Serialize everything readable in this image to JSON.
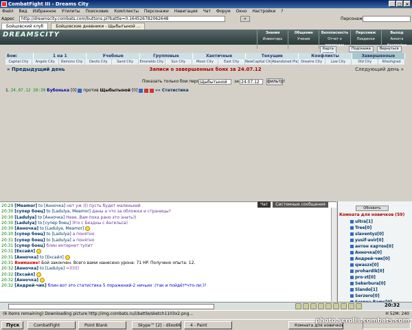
{
  "window": {
    "title": "CombatFight III - Dreams City"
  },
  "menu": [
    "Файл",
    "Вид",
    "Избранное",
    "Утилиты",
    "Поисковик",
    "Комплекты",
    "Персонажи",
    "Навигация",
    "Чат",
    "Форум",
    "Окно",
    "Настройки",
    "?"
  ],
  "address": {
    "label": "Адрес",
    "url": "http://dreamscity.combats.com/buttons.pl?battle=0.164526782062648",
    "go_label": "»",
    "person_label": "Персонаж:"
  },
  "tabs": [
    "Бойцовский клуб",
    "Бойцовские дневники - Щыбытыной ..."
  ],
  "dream": {
    "logo": "DREAMSCITY",
    "menus": [
      {
        "top": "Знания",
        "bottom": "Инвентарь"
      },
      {
        "top": "Общение",
        "bottom": "Учение"
      },
      {
        "top": "Безопасность",
        "bottom": "Отчет о переводах"
      },
      {
        "top": "Персонаж",
        "bottom": "Поединки"
      },
      {
        "top": "Выход",
        "bottom": "Анкета Настройки"
      }
    ]
  },
  "top_buttons": [
    "Карта миров",
    "Подсказка",
    "Вернуться"
  ],
  "categories": {
    "label": "Бои:",
    "items": [
      "1 на 1",
      "Учебные",
      "Групповые",
      "Хаотичные",
      "Текущие",
      "Конфликты",
      "Завершенные"
    ]
  },
  "subcities": [
    "Capital City",
    "Angels City",
    "Demons City",
    "Devils City",
    "Sand City",
    "Emeralds City",
    "Sun City",
    "Moon City",
    "East City",
    "NewCapital City",
    "Abandoned Plain",
    "Dreams City",
    "Low City",
    "Old City",
    "Kitezhgrad"
  ],
  "nav": {
    "prev": "« Предыдущий день",
    "title": "Записи о завершенных боях за 24.07.12",
    "next": "Следующий день »"
  },
  "filter": {
    "label": "Показать только бои персонажа:",
    "person": "Щыбытыной",
    "for_label": "за",
    "date": "24.07.12",
    "button": "фильтр!"
  },
  "battle": {
    "num": "1.",
    "date": "24.07.12 20:30",
    "p1": "Бубонька",
    "p1_level": "[0]",
    "vs": "против",
    "p2": "Щыбытыной",
    "p2_level": "[0]",
    "link": "»»",
    "stats": "Статистика"
  },
  "chat": {
    "tabs": [
      "Чат",
      "Системные сообщения"
    ],
    "lines": [
      {
        "t": "20:29",
        "n": "[Meamor]",
        "to": "to [Анночка]",
        "m": "нет уж ))) пусть будет маленький",
        "c": "pm"
      },
      {
        "t": "20:30",
        "n": "[супер боец]",
        "to": "to [Ladulya, Meamor]",
        "m": "даны а что за обложки и страницы?",
        "c": "pm"
      },
      {
        "t": "20:30",
        "n": "[Ladulya]",
        "to": "to [Анночка]",
        "m": "Неее..Вам пока рано это знать))",
        "c": "pm"
      },
      {
        "t": "20:30",
        "n": "[Ladulya]",
        "to": "to [супер боец]",
        "m": "Это с Бездны с Ангельса)",
        "c": "pm"
      },
      {
        "t": "20:30",
        "n": "[Анночка]",
        "to": "to [Ladulya, Meamor]",
        "m": "",
        "c": "pm",
        "s": true
      },
      {
        "t": "20:30",
        "n": "[супер боец]",
        "to": "to [Ladulya]",
        "m": "а понятно",
        "c": "pm"
      },
      {
        "t": "20:31",
        "n": "[супер боец]",
        "to": "to [Ladulya]",
        "m": "а понятно",
        "c": "pm"
      },
      {
        "t": "20:31",
        "n": "[супер боец]",
        "to": "",
        "m": "блин интернет тупит",
        "c": "pm"
      },
      {
        "t": "20:31",
        "n": "[Ексайл]",
        "to": "",
        "m": "",
        "c": "pm",
        "s": true
      },
      {
        "t": "20:31",
        "n": "[Анночка]",
        "to": "to [Ексайл]",
        "m": "",
        "c": "pm",
        "s": true
      },
      {
        "t": "20:31",
        "n": "",
        "to": "",
        "m": "Бой закончен. Всего вами нанесено урона: 71 HP. Получено опыта: 12.",
        "c": "",
        "sys": "Внимание!"
      },
      {
        "t": "20:32",
        "n": "[Анночка]",
        "to": "to [Ladulya]",
        "m": "=))))))",
        "c": "pm"
      },
      {
        "t": "20:32",
        "n": "[Ексайл]",
        "to": "",
        "m": "",
        "c": "pm",
        "s": true
      },
      {
        "t": "20:32",
        "n": "[Анночка]",
        "to": "",
        "m": "",
        "c": "pm",
        "s": true
      },
      {
        "t": "20:32",
        "n": "[Андрей-чик]",
        "to": "",
        "m": "блин вот это статистика 5 поражений-2 ничьих :)так и пойдёт*что-ли:)?",
        "c": "bl"
      }
    ]
  },
  "room": {
    "refresh": "Обновить",
    "title": "Комната для новичков (59)",
    "users": [
      "ultra[1]",
      "Tree[0]",
      "slaventyz[0]",
      "yusif-avir[0]",
      "антон картон[0]",
      "Анночка[0]",
      "Андрей-чик[0]",
      "qwaszx[0]",
      "prohardik[0]",
      "pro-zt[0]",
      "Sekerbura[0]",
      "Slando[1]",
      "Serzero[0]",
      "Sergey Rams[0]"
    ]
  },
  "input_clock": "20:32",
  "status": {
    "left": "(6 items remaining) Downloading picture http://img.combats.ru/i/battle/sketch1103x2.png...",
    "right": "H 52M: 240"
  },
  "taskbar": {
    "start": "Пуск",
    "tasks": [
      "CombatFight",
      "Point Blank",
      "Skype™ [2] - dlixo666",
      "4 - Paint",
      "Комната для новичков"
    ]
  },
  "watermark": "photo.scrolls.combats.com"
}
